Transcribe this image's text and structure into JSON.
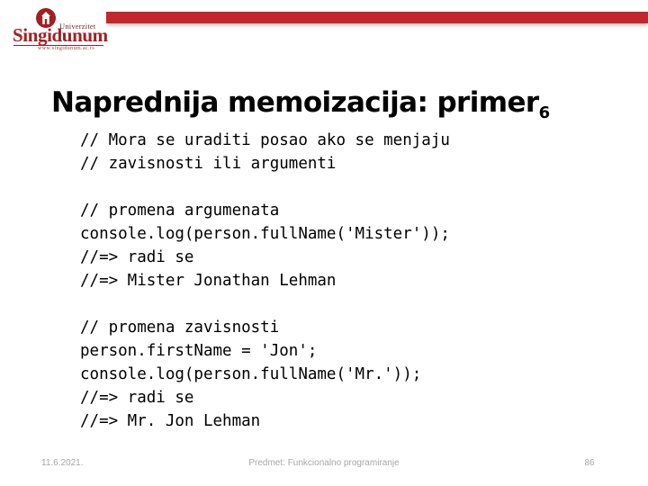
{
  "header": {
    "rule_color": "#C1272D",
    "logo": {
      "emblem_name": "singidunum-crest",
      "emblem_color": "#A02025",
      "superline": "Univerzitet",
      "wordmark": "Singidunum",
      "url": "www.singidunum.ac.rs"
    }
  },
  "title": {
    "main": "Naprednija memoizacija: primer",
    "subscript": "6"
  },
  "code": {
    "lines": [
      "// Mora se uraditi posao ako se menjaju",
      "// zavisnosti ili argumenti",
      "",
      "// promena argumenata",
      "console.log(person.fullName('Mister'));",
      "//=> radi se",
      "//=> Mister Jonathan Lehman",
      "",
      "// promena zavisnosti",
      "person.firstName = 'Jon';",
      "console.log(person.fullName('Mr.'));",
      "//=> radi se",
      "//=> Mr. Jon Lehman"
    ]
  },
  "footer": {
    "date": "11.6.2021.",
    "subject": "Predmet: Funkcionalno programiranje",
    "page": "86"
  }
}
